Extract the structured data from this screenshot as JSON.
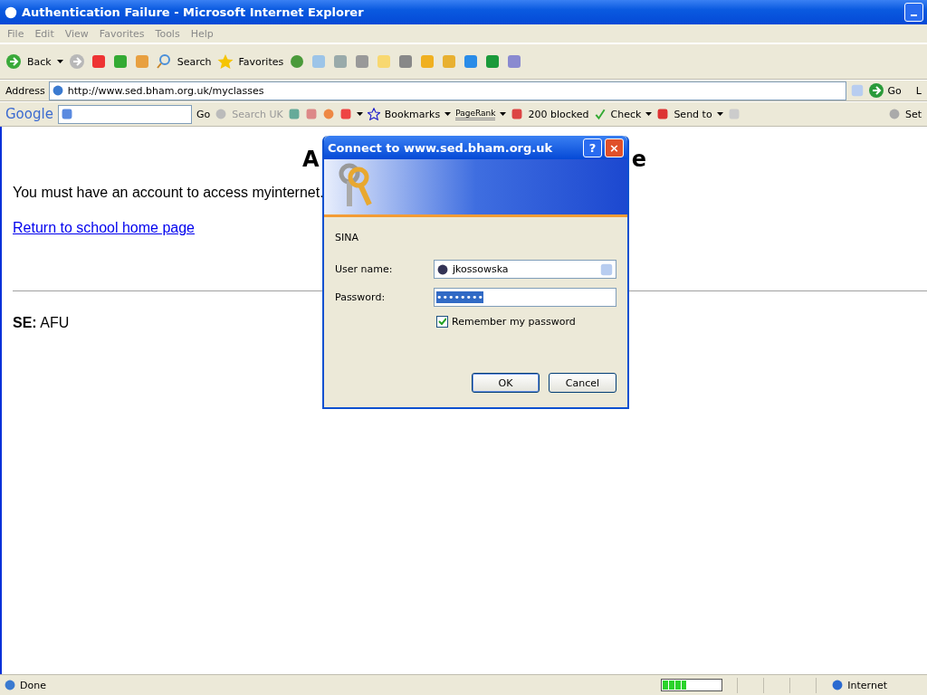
{
  "window": {
    "title": "Authentication Failure - Microsoft Internet Explorer"
  },
  "menu": [
    "File",
    "Edit",
    "View",
    "Favorites",
    "Tools",
    "Help"
  ],
  "toolbar": {
    "back": "Back",
    "search": "Search",
    "favorites": "Favorites"
  },
  "address_bar": {
    "label": "Address",
    "url": "http://www.sed.bham.org.uk/myclasses",
    "go": "Go",
    "links_cut": "L"
  },
  "google_bar": {
    "logo": "Google",
    "go": "Go",
    "search_site": "Search UK",
    "bookmarks": "Bookmarks",
    "pagerank": "PageRank",
    "blocked": "200 blocked",
    "check": "Check",
    "send_to": "Send to",
    "settings_cut": "Set"
  },
  "page": {
    "heading_parts": [
      "A",
      "e"
    ],
    "message": "You must have an account to access myinternet.",
    "link": "Return to school home page",
    "footer_label": "SE:",
    "footer_value": "AFU"
  },
  "dialog": {
    "title": "Connect to www.sed.bham.org.uk",
    "help": "?",
    "close": "×",
    "realm": "SINA",
    "username_label": "User name:",
    "username": "jkossowska",
    "password_label": "Password:",
    "password": "••••••••",
    "remember": {
      "label": "Remember my password",
      "checked": true
    },
    "ok": "OK",
    "cancel": "Cancel"
  },
  "status_bar": {
    "text": "Done",
    "level": 0.4,
    "zone": "Internet"
  }
}
